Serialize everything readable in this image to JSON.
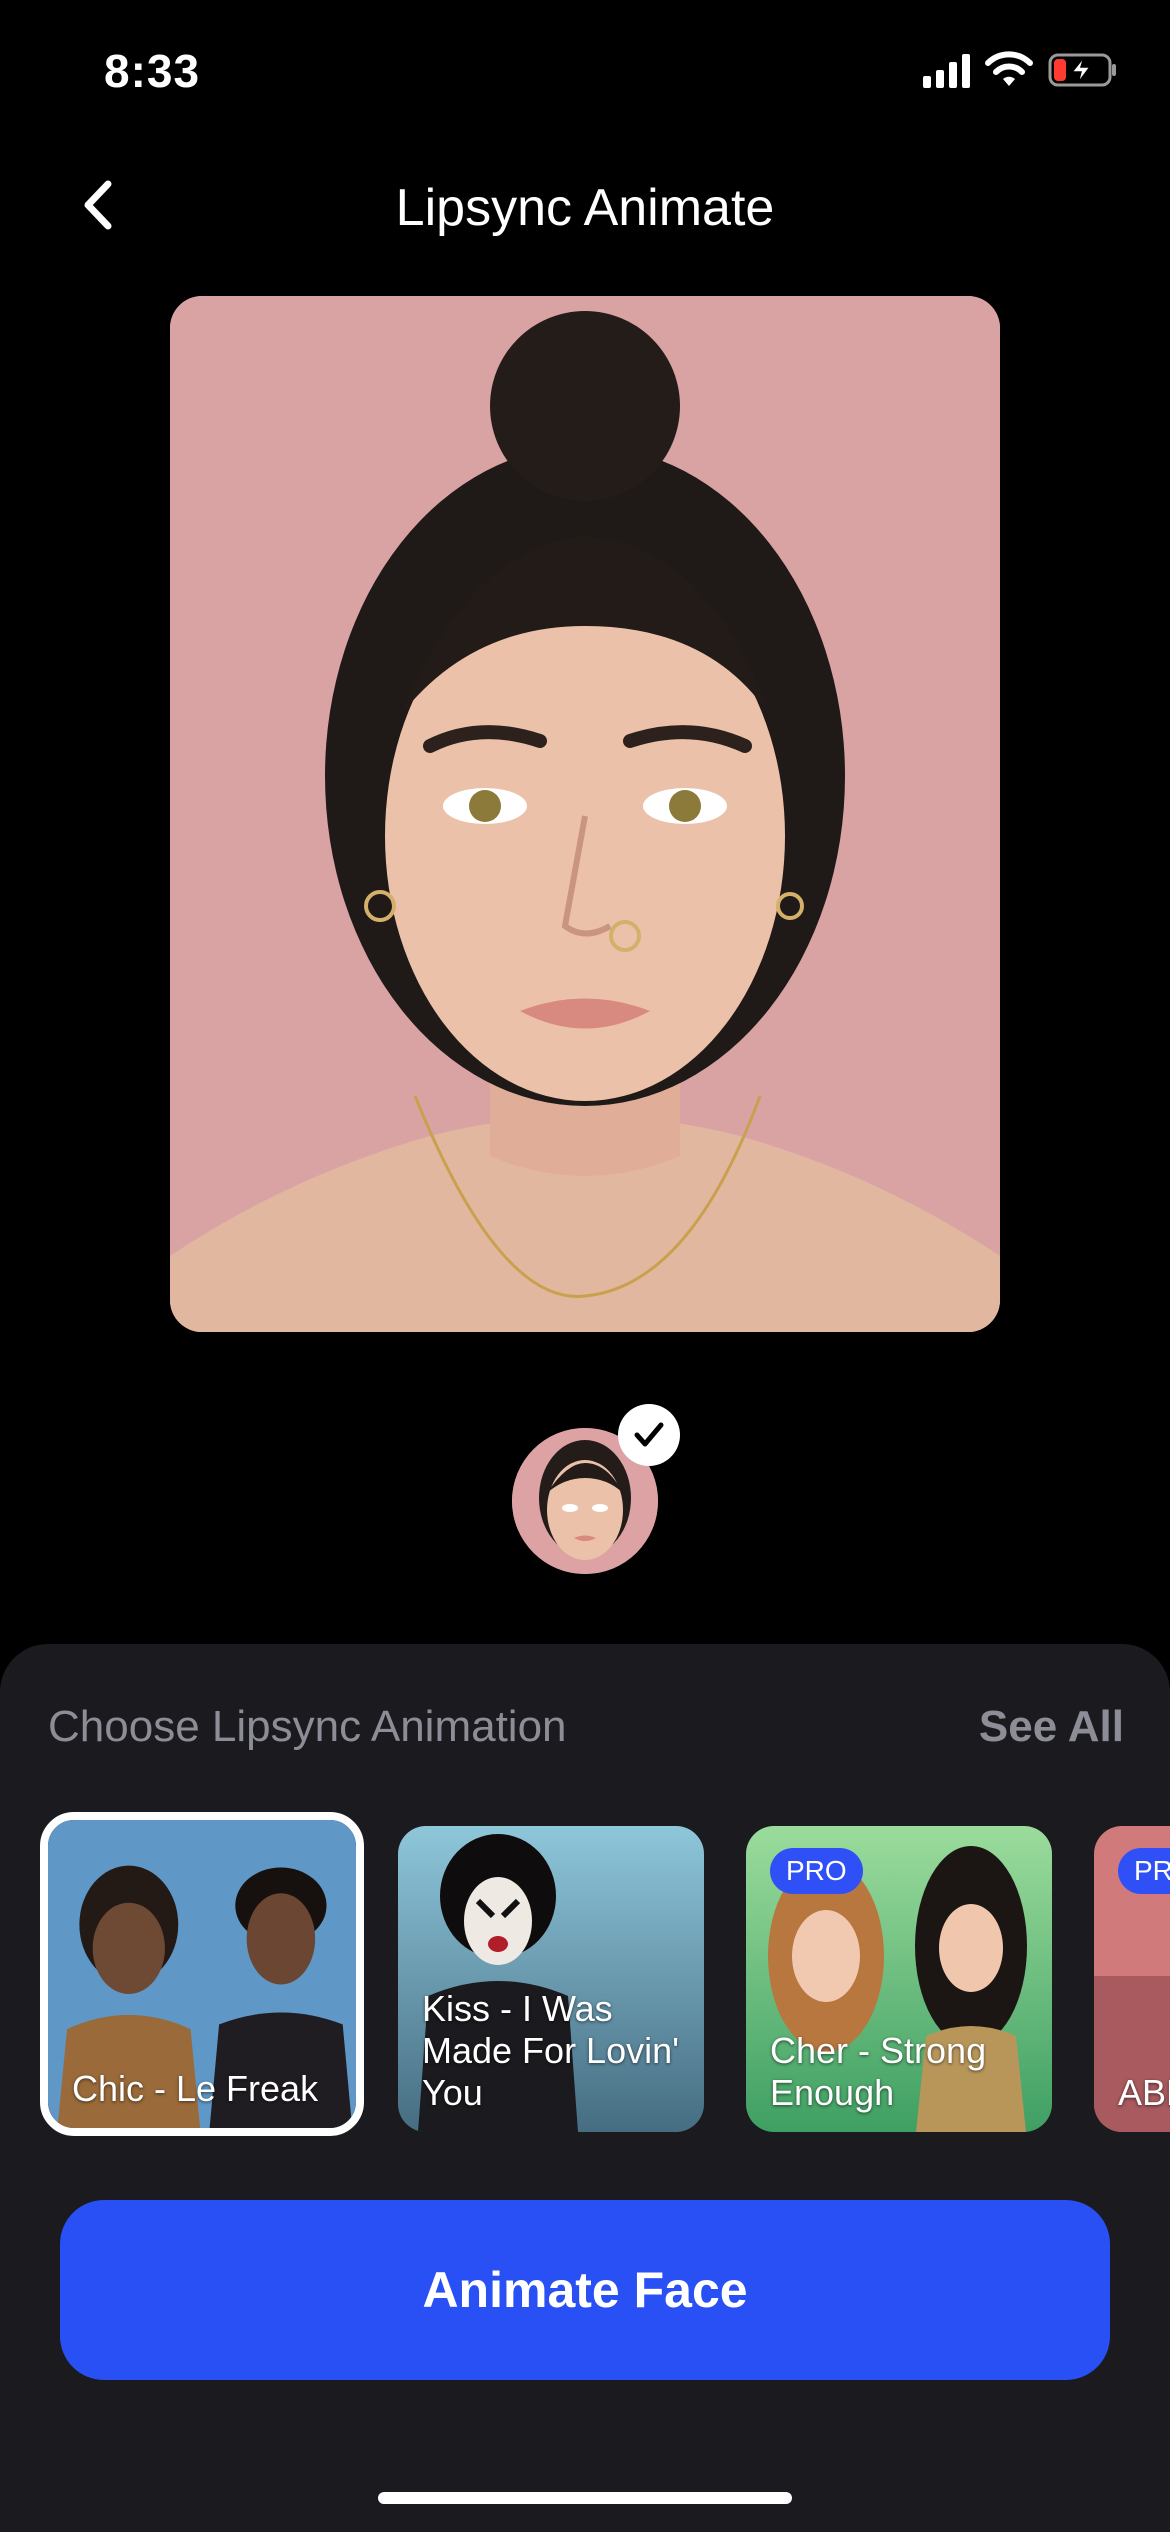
{
  "status": {
    "time": "8:33"
  },
  "header": {
    "title": "Lipsync Animate"
  },
  "sheet": {
    "title": "Choose Lipsync Animation",
    "see_all": "See All",
    "cards": [
      {
        "label": "Chic - Le Freak",
        "pro": "",
        "selected": true
      },
      {
        "label": "Kiss - I Was Made For Lovin' You",
        "pro": ""
      },
      {
        "label": "Cher - Strong Enough",
        "pro": "PRO"
      },
      {
        "label": "ABBA - Ma",
        "pro": "PRO"
      }
    ]
  },
  "cta": {
    "label": "Animate Face"
  },
  "colors": {
    "accent": "#2950f5",
    "sheet_bg": "#1b1b1f",
    "pro_badge": "#2f50f6",
    "photo_bg": "#d9a3a4"
  }
}
